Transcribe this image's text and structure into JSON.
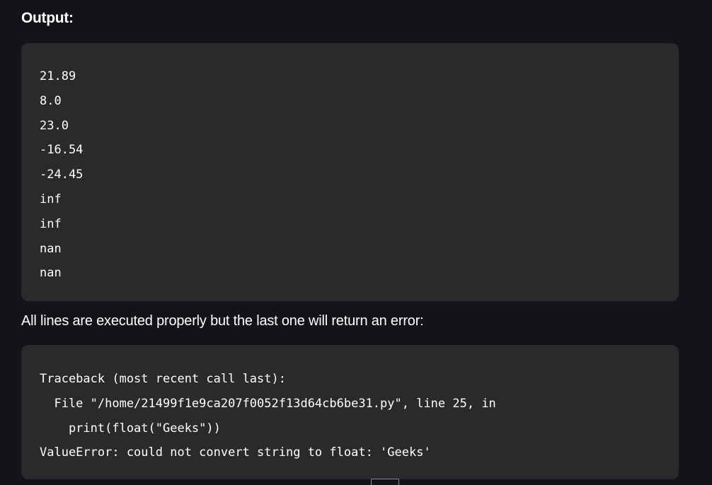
{
  "output_heading": "Output:",
  "output_lines": [
    "21.89",
    "8.0",
    "23.0",
    "-16.54",
    "-24.45",
    "inf",
    "inf",
    "nan",
    "nan"
  ],
  "explanation": "All lines are executed properly but the last one will return an error:",
  "traceback_lines": [
    "Traceback (most recent call last):",
    "  File \"/home/21499f1e9ca207f0052f13d64cb6be31.py\", line 25, in",
    "    print(float(\"Geeks\"))",
    "ValueError: could not convert string to float: 'Geeks'"
  ],
  "colors": {
    "page_background": "#131417",
    "code_background": "#2a2a2d",
    "text": "#ffffff"
  }
}
